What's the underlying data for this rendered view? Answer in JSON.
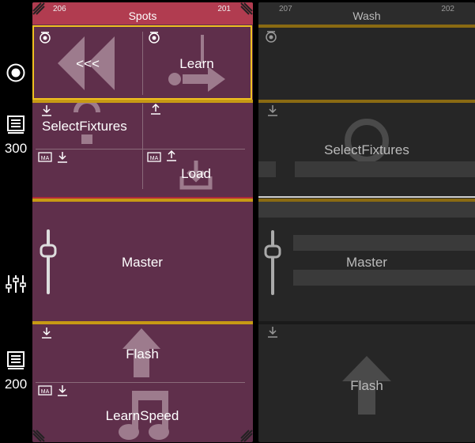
{
  "sidebar": {
    "page_a_number": "300",
    "page_b_number": "200"
  },
  "spots": {
    "title": "Spots",
    "number_left": "206",
    "number_right": "201",
    "buttons": {
      "rewind_label": "<<<",
      "learn_label": "Learn",
      "select_fixtures_label": "SelectFixtures",
      "load_label": "Load",
      "master_label": "Master",
      "flash_label": "Flash",
      "learn_speed_label": "LearnSpeed"
    },
    "colors": {
      "panel_bg": "#5f2f4b",
      "header_bg": "#b13c50",
      "accent": "#c79a14",
      "selection": "#f0c020"
    }
  },
  "wash": {
    "title": "Wash",
    "number_left": "207",
    "number_right": "202",
    "buttons": {
      "select_fixtures_label": "SelectFixtures",
      "master_label": "Master",
      "flash_label": "Flash"
    },
    "colors": {
      "panel_bg": "#262626",
      "accent": "#8a6a12"
    }
  }
}
